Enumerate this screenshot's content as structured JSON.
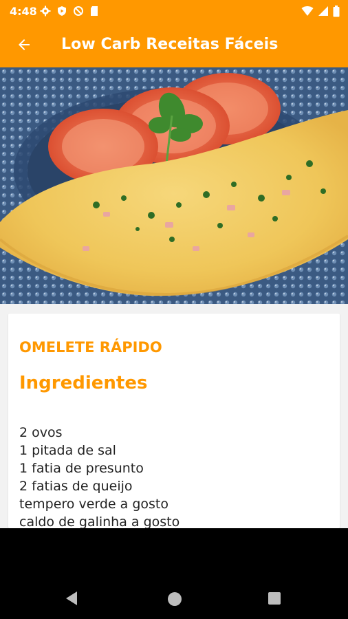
{
  "status_bar": {
    "time": "4:48",
    "icons_left": [
      "gear-icon",
      "shield-icon",
      "no-sync-icon",
      "sd-card-icon"
    ],
    "icons_right": [
      "wifi-icon",
      "signal-icon",
      "battery-icon"
    ]
  },
  "app_bar": {
    "title": "Low Carb Receitas Fáceis",
    "back_icon": "arrow-back-icon"
  },
  "recipe": {
    "name": "OMELETE RÁPIDO",
    "section_title": "Ingredientes",
    "ingredients": [
      "2 ovos",
      "1 pitada de sal",
      "1 fatia de presunto",
      "2 fatias de queijo",
      "tempero verde a gosto",
      "caldo de galinha a gosto"
    ]
  },
  "nav_bar": {
    "buttons": [
      "nav-back-icon",
      "nav-home-icon",
      "nav-recents-icon"
    ]
  },
  "colors": {
    "accent": "#ff9800",
    "text": "#222222",
    "background": "#f2f2f2"
  }
}
